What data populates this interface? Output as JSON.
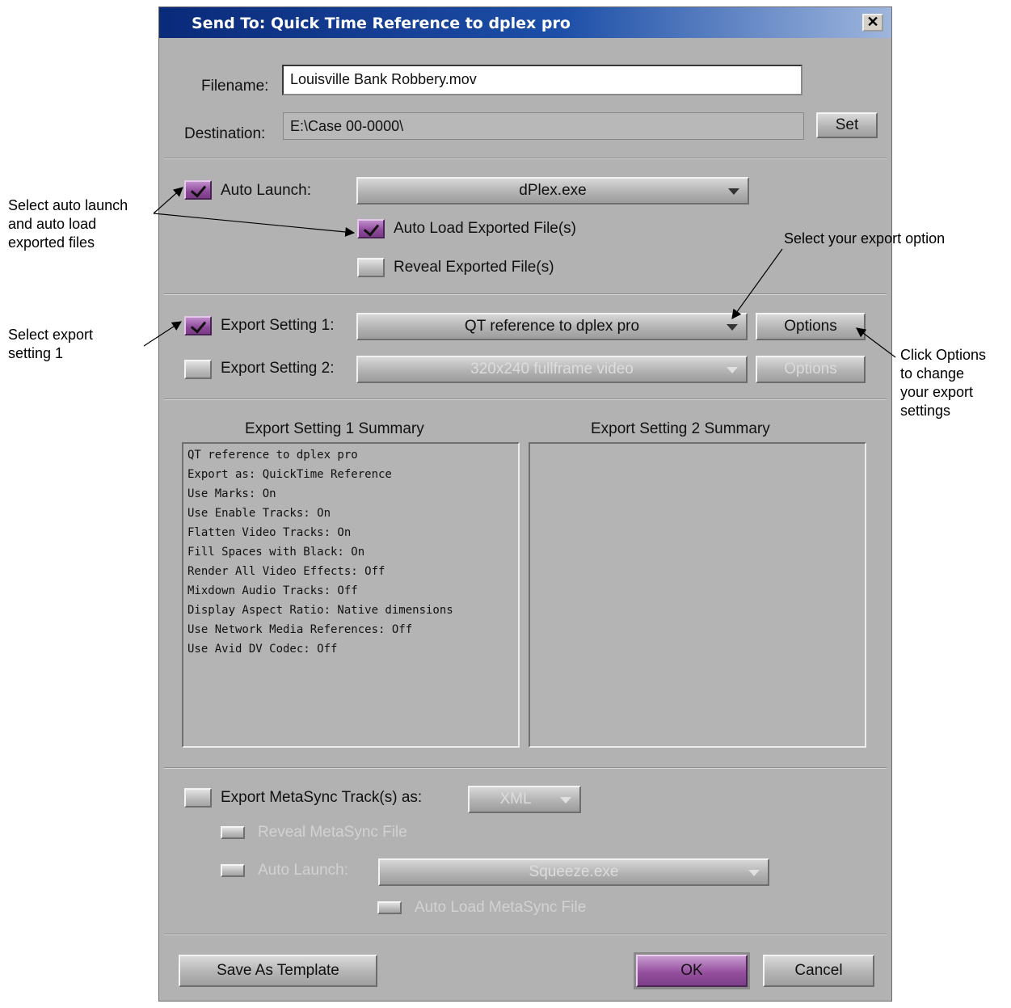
{
  "dialog": {
    "title": "Send To: Quick Time Reference to dplex pro",
    "close_glyph": "✕"
  },
  "file": {
    "filename_label": "Filename:",
    "filename_value": "Louisville Bank Robbery.mov",
    "destination_label": "Destination:",
    "destination_value": "E:\\Case 00-0000\\",
    "set_label": "Set"
  },
  "launch": {
    "auto_launch_label": "Auto Launch:",
    "auto_launch_checked": true,
    "auto_launch_app": "dPlex.exe",
    "auto_load_label": "Auto Load Exported File(s)",
    "auto_load_checked": true,
    "reveal_label": "Reveal Exported File(s)",
    "reveal_checked": false
  },
  "export": {
    "setting1_label": "Export Setting 1:",
    "setting1_checked": true,
    "setting1_value": "QT reference to dplex pro",
    "setting1_options": "Options",
    "setting2_label": "Export Setting 2:",
    "setting2_checked": false,
    "setting2_value": "320x240 fullframe video",
    "setting2_options": "Options"
  },
  "summary": {
    "title1": "Export Setting 1 Summary",
    "title2": "Export Setting 2 Summary",
    "lines1": [
      "QT reference to dplex pro",
      "Export as: QuickTime Reference",
      "Use Marks: On",
      "Use Enable Tracks: On",
      "Flatten Video Tracks: On",
      "Fill Spaces with Black: On",
      "Render All Video Effects: Off",
      "Mixdown Audio Tracks: Off",
      "Display Aspect Ratio: Native dimensions",
      "Use Network Media References: Off",
      "Use Avid DV Codec: Off"
    ]
  },
  "metasync": {
    "export_label": "Export MetaSync Track(s) as:",
    "export_checked": false,
    "format": "XML",
    "reveal_label": "Reveal MetaSync File",
    "auto_launch_label": "Auto Launch:",
    "auto_launch_app": "Squeeze.exe",
    "auto_load_label": "Auto Load MetaSync File"
  },
  "footer": {
    "save_template": "Save As Template",
    "ok": "OK",
    "cancel": "Cancel"
  },
  "annotations": {
    "auto_launch_note": [
      "Select auto launch",
      "and auto load",
      "exported files"
    ],
    "export_option_note": "Select your export option",
    "export_setting_note": [
      "Select export",
      "setting 1"
    ],
    "options_note": [
      "Click Options",
      "to change",
      "your export",
      "settings"
    ]
  }
}
